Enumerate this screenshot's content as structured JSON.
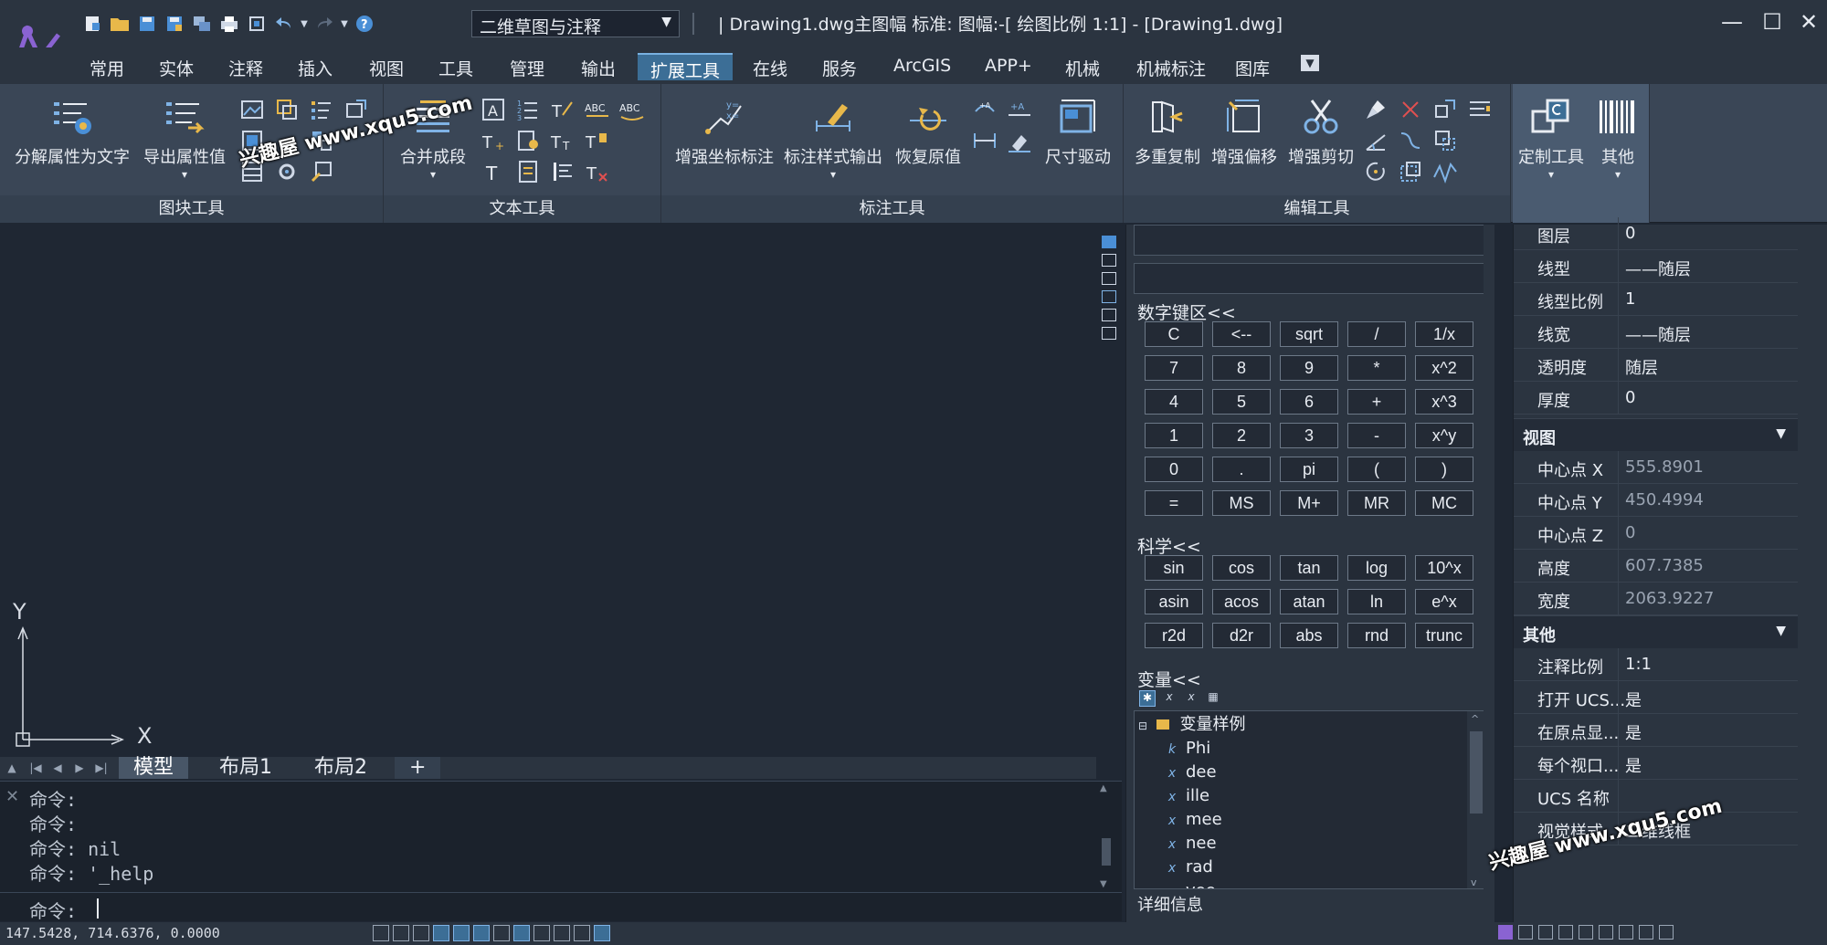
{
  "titlebar": {
    "workspace": "二维草图与注释",
    "title": "| Drawing1.dwg主图幅  标准: 图幅:-[ 绘图比例 1:1] - [Drawing1.dwg]",
    "qat_icons": [
      "new-icon",
      "open-icon",
      "save-icon",
      "save-as-icon",
      "layers-icon",
      "print-icon",
      "zoom-extents-icon",
      "undo-icon",
      "redo-icon",
      "help-icon"
    ]
  },
  "menu": {
    "tabs": [
      "常用",
      "实体",
      "注释",
      "插入",
      "视图",
      "工具",
      "管理",
      "输出",
      "扩展工具",
      "在线",
      "服务",
      "ArcGIS",
      "APP+",
      "机械",
      "机械标注",
      "图库"
    ],
    "active": "扩展工具"
  },
  "ribbon": {
    "groups": {
      "block": "图块工具",
      "text": "文本工具",
      "dim": "标注工具",
      "edit": "编辑工具"
    },
    "buttons": {
      "explode_attr": "分解属性为文字",
      "export_attr": "导出属性值",
      "merge_para": "合并成段",
      "enh_coord_dim": "增强坐标标注",
      "dim_style_out": "标注样式输出",
      "restore_value": "恢复原值",
      "dim_drive": "尺寸驱动",
      "multi_copy": "多重复制",
      "enh_offset": "增强偏移",
      "enh_trim": "增强剪切",
      "custom_tools": "定制工具",
      "other": "其他"
    }
  },
  "canvas": {
    "axis_x": "X",
    "axis_y": "Y"
  },
  "layout_tabs": [
    "模型",
    "布局1",
    "布局2",
    "+"
  ],
  "command": {
    "history": [
      "命令:",
      "命令:",
      "命令: nil",
      "命令: '_help"
    ],
    "prompt": "命令:"
  },
  "status": {
    "coords": "147.5428,  714.6376,  0.0000"
  },
  "calculator": {
    "numpad_title": "数字键区<<",
    "numpad": [
      [
        "C",
        "<--",
        "sqrt",
        "/",
        "1/x"
      ],
      [
        "7",
        "8",
        "9",
        "*",
        "x^2"
      ],
      [
        "4",
        "5",
        "6",
        "+",
        "x^3"
      ],
      [
        "1",
        "2",
        "3",
        "-",
        "x^y"
      ],
      [
        "0",
        ".",
        "pi",
        "(",
        ")"
      ],
      [
        "=",
        "MS",
        "M+",
        "MR",
        "MC"
      ]
    ],
    "sci_title": "科学<<",
    "sci": [
      [
        "sin",
        "cos",
        "tan",
        "log",
        "10^x"
      ],
      [
        "asin",
        "acos",
        "atan",
        "ln",
        "e^x"
      ],
      [
        "r2d",
        "d2r",
        "abs",
        "rnd",
        "trunc"
      ]
    ],
    "var_title": "变量<<",
    "var_root": "变量样例",
    "variables": [
      {
        "icon": "k",
        "name": "Phi"
      },
      {
        "icon": "x",
        "name": "dee"
      },
      {
        "icon": "x",
        "name": "ille"
      },
      {
        "icon": "x",
        "name": "mee"
      },
      {
        "icon": "x",
        "name": "nee"
      },
      {
        "icon": "x",
        "name": "rad"
      },
      {
        "icon": "x",
        "name": "vee"
      }
    ],
    "details": "详细信息"
  },
  "properties": {
    "general_rows": [
      {
        "name": "图层",
        "value": "0"
      },
      {
        "name": "线型",
        "value": "——随层"
      },
      {
        "name": "线型比例",
        "value": "1"
      },
      {
        "name": "线宽",
        "value": "——随层"
      },
      {
        "name": "透明度",
        "value": "随层"
      },
      {
        "name": "厚度",
        "value": "0"
      }
    ],
    "view_title": "视图",
    "view_rows": [
      {
        "name": "中心点 X",
        "value": "555.8901"
      },
      {
        "name": "中心点 Y",
        "value": "450.4994"
      },
      {
        "name": "中心点 Z",
        "value": "0"
      },
      {
        "name": "高度",
        "value": "607.7385"
      },
      {
        "name": "宽度",
        "value": "2063.9227"
      }
    ],
    "misc_title": "其他",
    "misc_rows": [
      {
        "name": "注释比例",
        "value": "1:1"
      },
      {
        "name": "打开 UCS...",
        "value": "是"
      },
      {
        "name": "在原点显...",
        "value": "是"
      },
      {
        "name": "每个视口...",
        "value": "是"
      },
      {
        "name": "UCS 名称",
        "value": ""
      },
      {
        "name": "视觉样式",
        "value": "二维线框"
      }
    ]
  },
  "watermark": "兴趣屋 www.xqu5.com",
  "colors": {
    "accent": "#3c6e96",
    "canvas_bg": "#1f2733",
    "panel_bg": "#2b3440"
  }
}
